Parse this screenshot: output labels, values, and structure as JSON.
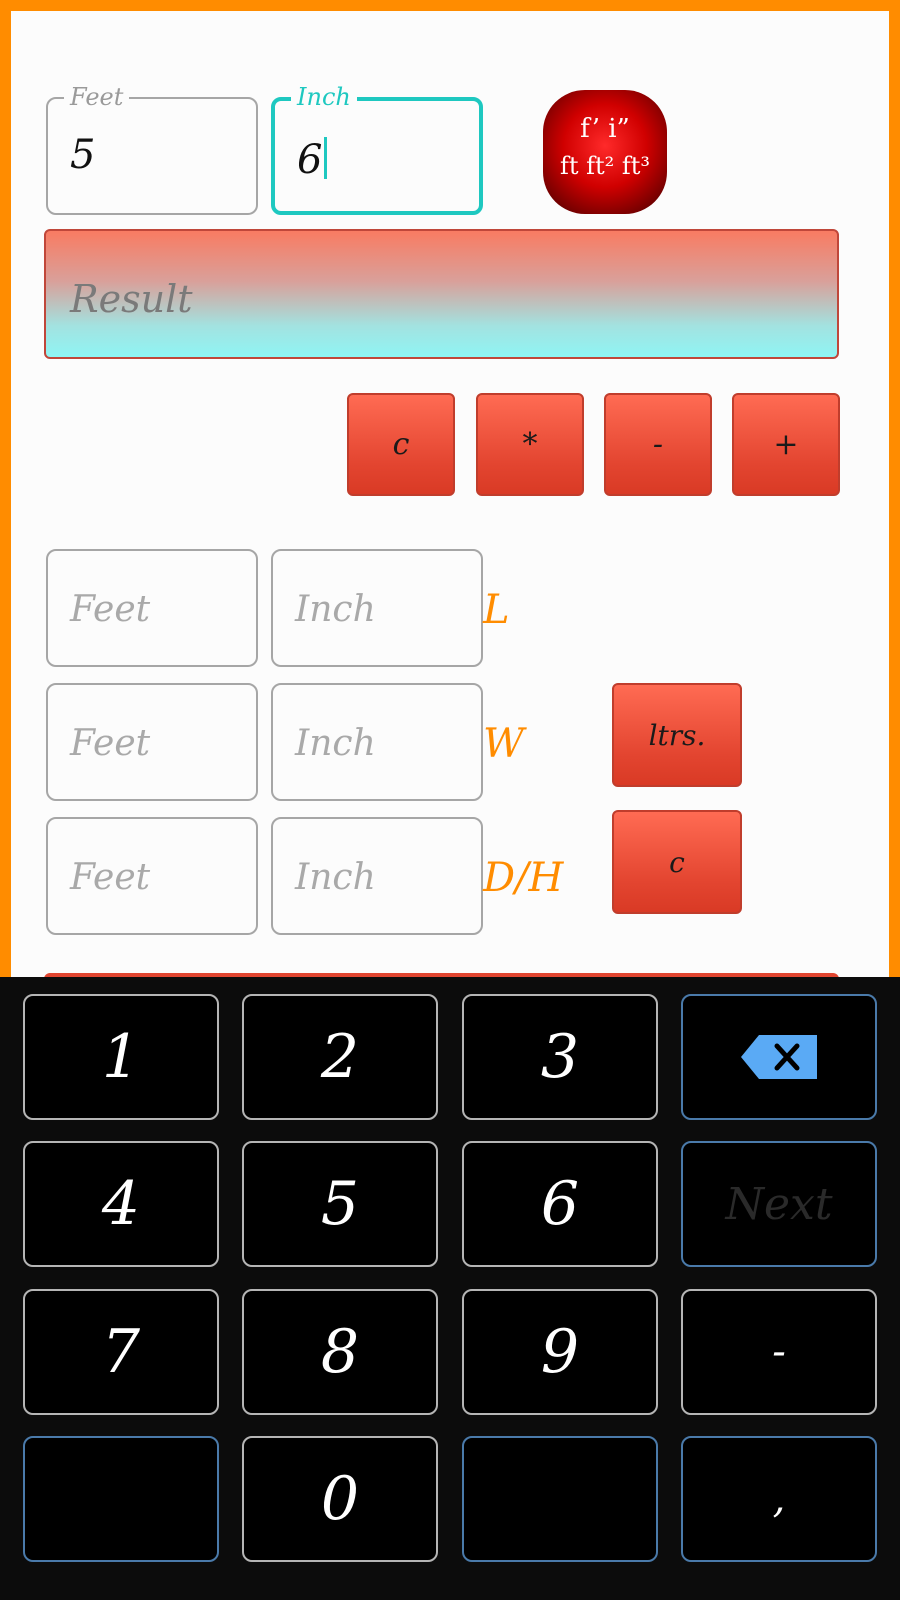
{
  "top": {
    "feet_legend": "Feet",
    "feet_value": "5",
    "inch_legend": "Inch",
    "inch_value": "6",
    "unit_badge_line1": "f’ i”",
    "unit_badge_line2": "ft ft² ft³"
  },
  "result_placeholder": "Result",
  "ops": {
    "clear": "c",
    "multiply": "*",
    "minus": "-",
    "plus": "+"
  },
  "dimensions": {
    "feet_placeholder": "Feet",
    "inch_placeholder": "Inch",
    "length_label": "L",
    "width_label": "W",
    "depth_label": "D/H",
    "liters_button": "ltrs.",
    "clear_button": "c"
  },
  "keyboard": {
    "k1": "1",
    "k2": "2",
    "k3": "3",
    "k4": "4",
    "k5": "5",
    "k6": "6",
    "k7": "7",
    "k8": "8",
    "k9": "9",
    "k0": "0",
    "next": "Next",
    "minus": "-",
    "comma": ",",
    "delete_icon": "backspace-icon"
  },
  "colors": {
    "frame": "#ff8c00",
    "accent": "#1ec8c0",
    "button": "#e34530",
    "label": "#ff8c00"
  }
}
